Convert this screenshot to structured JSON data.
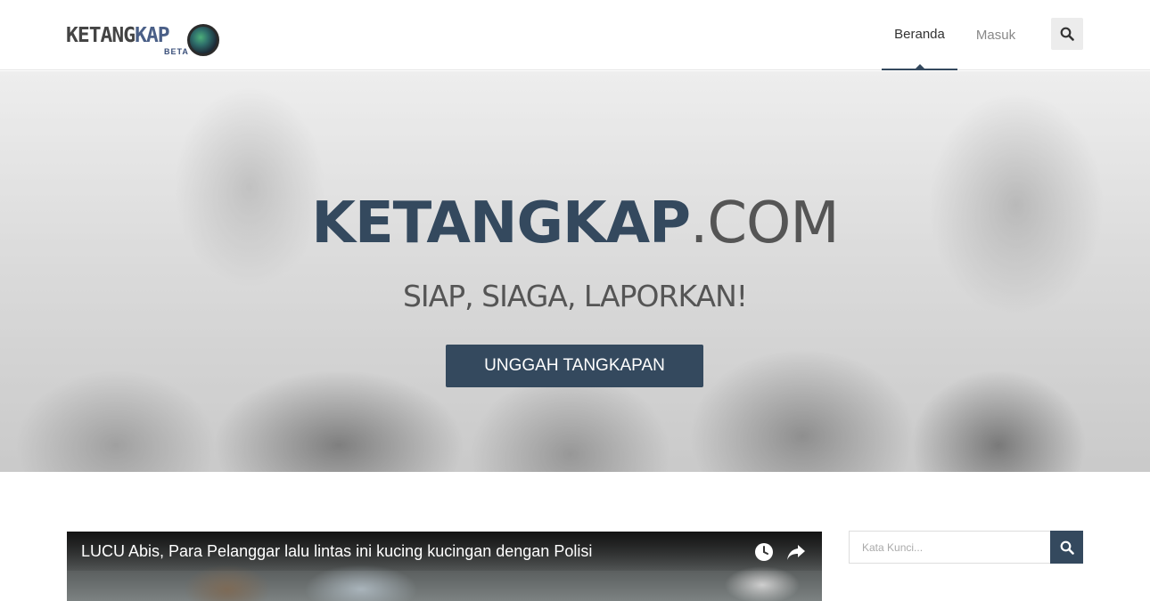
{
  "header": {
    "logo_text_a": "KETANG",
    "logo_text_b": "KAP",
    "logo_beta": "BETA",
    "nav": {
      "home": "Beranda",
      "login": "Masuk"
    },
    "search_icon": "search-icon"
  },
  "hero": {
    "title_strong": "KETANGKAP",
    "title_light": ".COM",
    "subtitle": "SIAP, SIAGA, LAPORKAN!",
    "cta": "UNGGAH TANGKAPAN"
  },
  "video": {
    "title": "LUCU Abis, Para Pelanggar lalu lintas ini kucing kucingan dengan Polisi",
    "icons": [
      "clock-icon",
      "share-icon"
    ]
  },
  "sidebar": {
    "search_placeholder": "Kata Kunci...",
    "search_icon": "search-icon"
  },
  "colors": {
    "accent": "#34495e",
    "header_bg": "#ffffff",
    "search_bg": "#ececec"
  }
}
